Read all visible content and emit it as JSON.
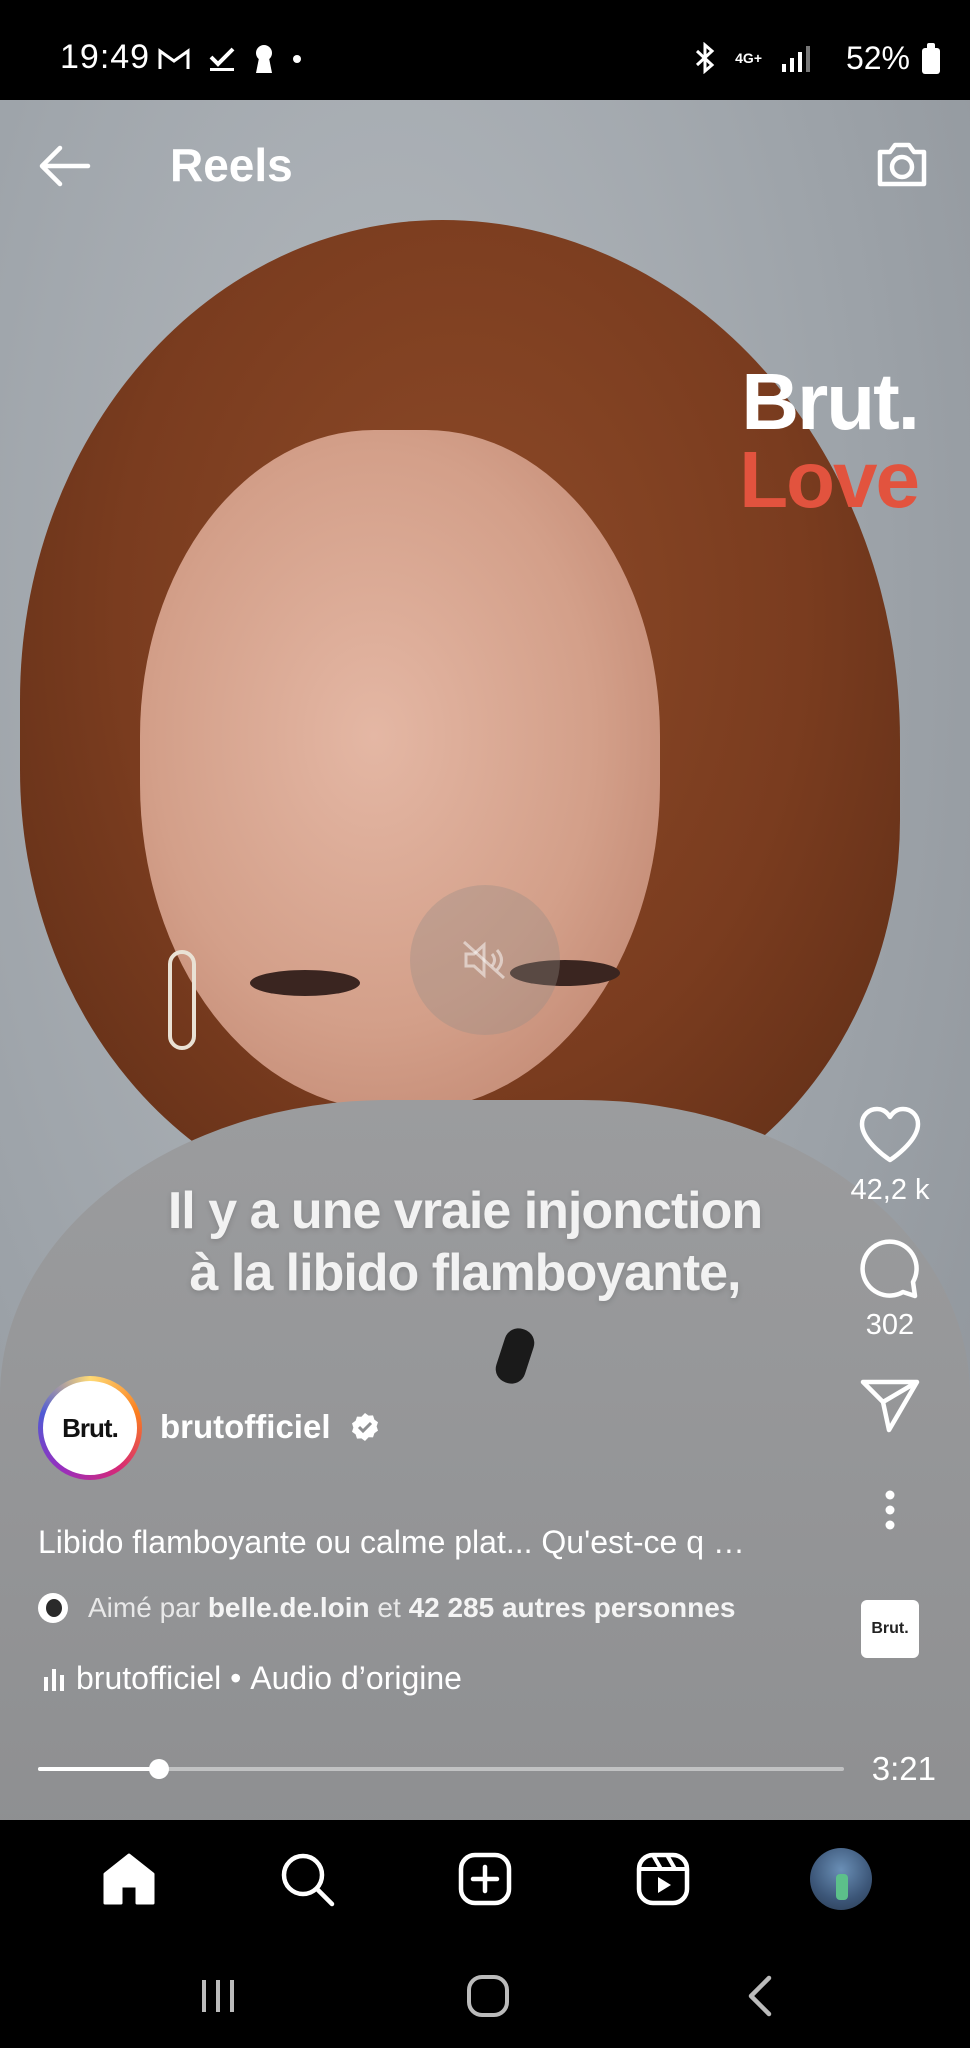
{
  "status_bar": {
    "time": "19:49",
    "network": "4G+",
    "battery": "52%"
  },
  "header": {
    "title": "Reels",
    "back_icon": "arrow-left-icon",
    "camera_icon": "camera-icon"
  },
  "watermark": {
    "line1": "Brut.",
    "line2": "Love",
    "line2_color": "#e2533e"
  },
  "video": {
    "caption_line1": "Il y a une vraie injonction",
    "caption_line2": "à la libido flamboyante,",
    "muted": true
  },
  "actions": {
    "likes": "42,2 k",
    "comments": "302",
    "audio_thumb_label": "Brut."
  },
  "post": {
    "avatar_label": "Brut.",
    "username": "brutofficiel",
    "verified": true,
    "description": "Libido flamboyante ou calme plat... Qu'est-ce q …",
    "liked_prefix": "Aimé par",
    "liked_user": "belle.de.loin",
    "liked_connector": "et",
    "liked_others": "42 285 autres personnes",
    "audio_owner": "brutofficiel",
    "audio_separator": "•",
    "audio_label": "Audio d’origine"
  },
  "playback": {
    "progress_fraction": 0.15,
    "duration": "3:21"
  },
  "bottom_nav": {
    "items": [
      "home-icon",
      "search-icon",
      "create-icon",
      "reels-icon",
      "profile-avatar"
    ]
  },
  "system_nav": [
    "recent-apps-icon",
    "home-circle-icon",
    "back-chevron-icon"
  ]
}
